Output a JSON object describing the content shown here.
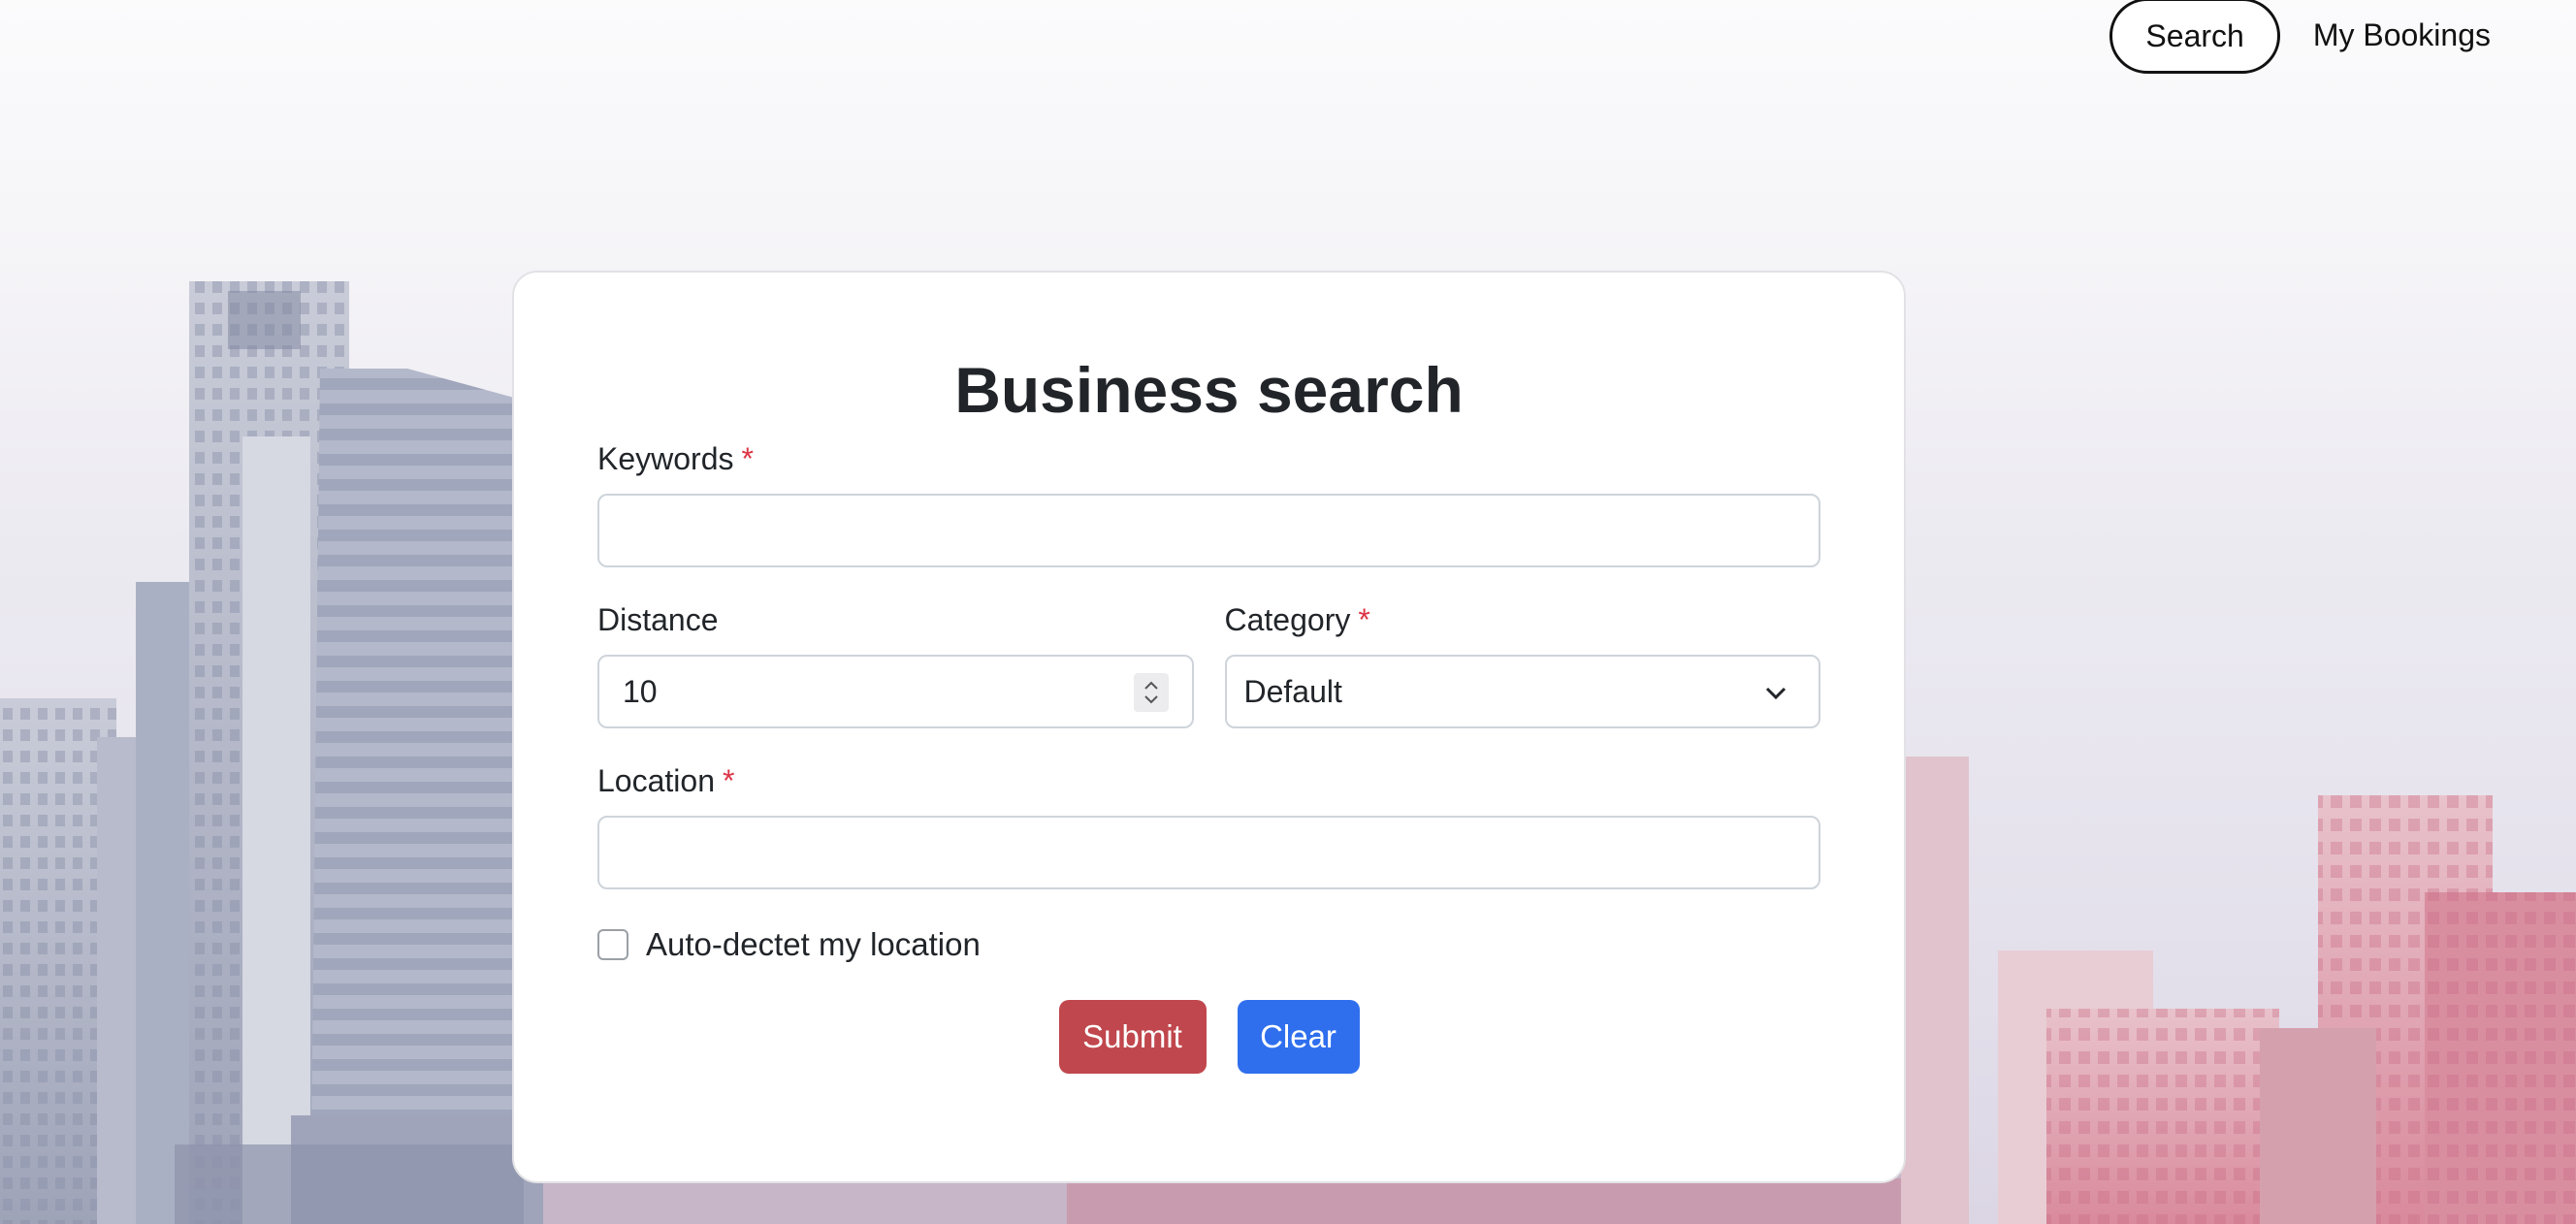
{
  "nav": {
    "search_label": "Search",
    "bookings_label": "My Bookings"
  },
  "form": {
    "title": "Business search",
    "keywords": {
      "label": "Keywords",
      "required_mark": "*",
      "value": ""
    },
    "distance": {
      "label": "Distance",
      "value": "10"
    },
    "category": {
      "label": "Category",
      "required_mark": "*",
      "selected": "Default"
    },
    "location": {
      "label": "Location",
      "required_mark": "*",
      "value": ""
    },
    "auto_detect": {
      "label": "Auto-dectet my location",
      "checked": false
    },
    "submit_label": "Submit",
    "clear_label": "Clear"
  },
  "colors": {
    "submit": "#c0474d",
    "clear": "#2f6fee",
    "required": "#dc3545"
  }
}
